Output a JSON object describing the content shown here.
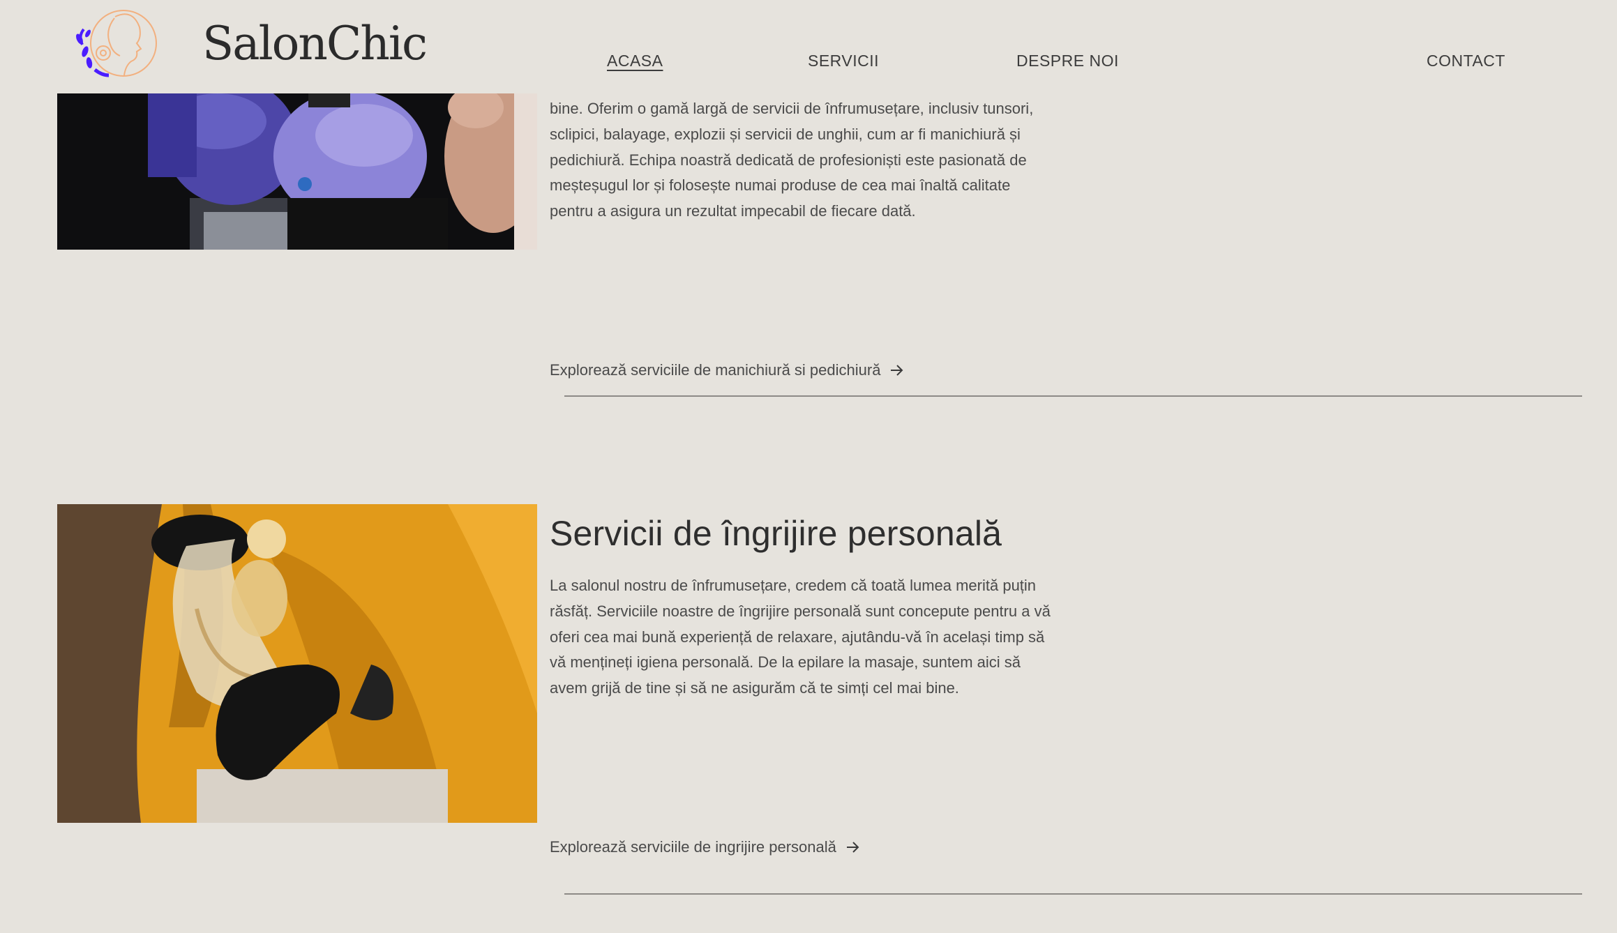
{
  "header": {
    "brand": "SalonChic",
    "nav": {
      "home": "ACASA",
      "services": "SERVICII",
      "about": "DESPRE NOI",
      "contact": "CONTACT"
    }
  },
  "section_manicure": {
    "description": "bine. Oferim o gamă largă de servicii de înfrumusețare, inclusiv tunsori, sclipici, balayage, explozii și servicii de unghii, cum ar fi manichiură și pedichiură. Echipa noastră dedicată de profesioniști este pasionată de meșteșugul lor și folosește numai produse de cea mai înaltă calitate pentru a asigura un rezultat impecabil de fiecare dată.",
    "link": "Explorează serviciile de manichiură si pedichiură"
  },
  "section_personal_care": {
    "title": "Servicii de îngrijire personală",
    "description": "La salonul nostru de înfrumusețare, credem că toată lumea merită puțin răsfăț. Serviciile noastre de îngrijire personală sunt concepute pentru a vă oferi cea mai bună experiență de relaxare, ajutându-vă în același timp să vă mențineți igiena personală. De la epilare la masaje, suntem aici să avem grijă de tine și să ne asigurăm că te simți cel mai bine.",
    "link": "Explorează serviciile de ingrijire personală"
  },
  "icons": {
    "logo": "woman-face-logo-icon",
    "link_arrow": "arrow-right-icon"
  },
  "colors": {
    "background": "#e6e3dd",
    "logo_line": "#f2b07f",
    "logo_leaves": "#4b1dff",
    "divider": "#8d8a86"
  }
}
